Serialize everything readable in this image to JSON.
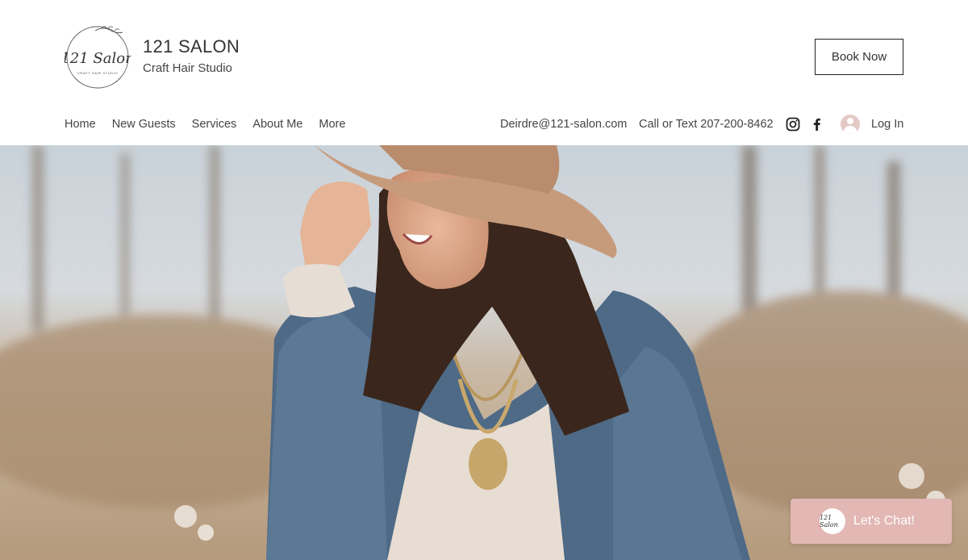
{
  "brand": {
    "name": "121 SALON",
    "tagline": "Craft Hair Studio",
    "logo_text": "121 Salon",
    "logo_subtext": "CRAFT HAIR STUDIO"
  },
  "header": {
    "book_label": "Book Now",
    "email": "Deirdre@121-salon.com",
    "phone": "Call or Text 207-200-8462",
    "login_label": "Log In"
  },
  "nav": {
    "items": [
      {
        "label": "Home"
      },
      {
        "label": "New Guests"
      },
      {
        "label": "Services"
      },
      {
        "label": "About Me"
      },
      {
        "label": "More"
      }
    ]
  },
  "social": {
    "icons": [
      "instagram-icon",
      "facebook-icon"
    ]
  },
  "chat": {
    "label": "Let's Chat!",
    "avatar_text": "121 Salon"
  },
  "colors": {
    "chat_bg": "#e2b7b4",
    "text": "#444444",
    "avatar_bg": "#e3c9c6"
  }
}
